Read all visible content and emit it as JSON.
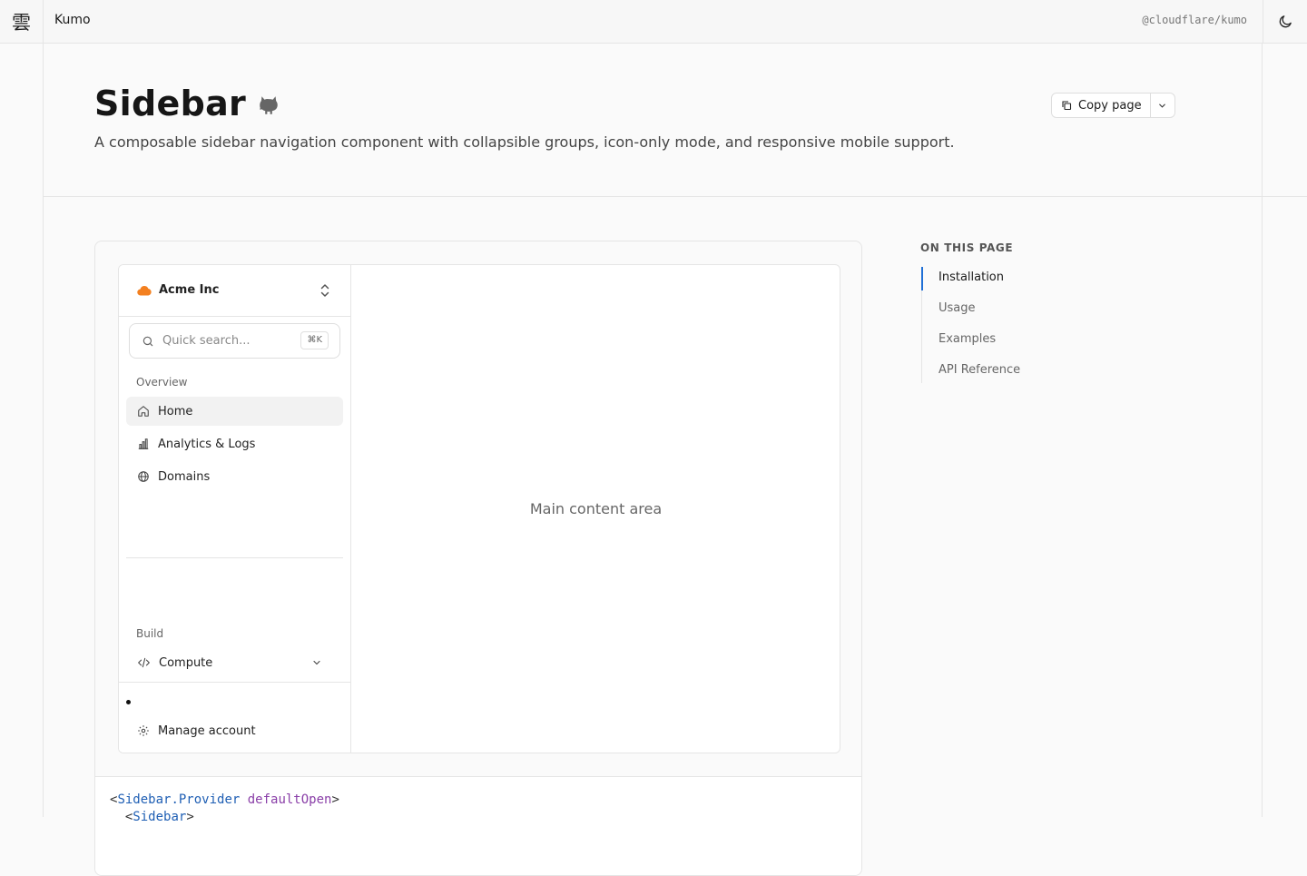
{
  "topbar": {
    "logo_glyph": "雲",
    "brand": "Kumo",
    "package": "@cloudflare/kumo",
    "theme_icon": "moon-icon"
  },
  "header": {
    "title": "Sidebar",
    "title_icon": "github-icon",
    "description": "A composable sidebar navigation component with collapsible groups, icon-only mode, and responsive mobile support.",
    "copy_label": "Copy page",
    "copy_icon": "copy-icon",
    "copy_menu_icon": "chevron-down-icon"
  },
  "demo": {
    "org": {
      "name": "Acme Inc",
      "logo_icon": "cloud-logo-icon",
      "logo_color": "#f38020"
    },
    "search": {
      "placeholder": "Quick search...",
      "shortcut": "⌘K"
    },
    "groups": {
      "overview": "Overview",
      "build": "Build"
    },
    "nav": {
      "home": "Home",
      "analytics": "Analytics & Logs",
      "domains": "Domains",
      "compute": "Compute"
    },
    "footer": {
      "manage": "Manage account"
    },
    "main": "Main content area"
  },
  "code": {
    "line1": {
      "open": "<",
      "component": "Sidebar.Provider",
      "attr": " defaultOpen",
      "close": ">"
    },
    "line2": {
      "open": "  <",
      "component": "Sidebar",
      "close": ">"
    }
  },
  "toc": {
    "title": "ON THIS PAGE",
    "items": [
      "Installation",
      "Usage",
      "Examples",
      "API Reference"
    ],
    "active": "Installation",
    "accent": "#1f6fd6"
  }
}
